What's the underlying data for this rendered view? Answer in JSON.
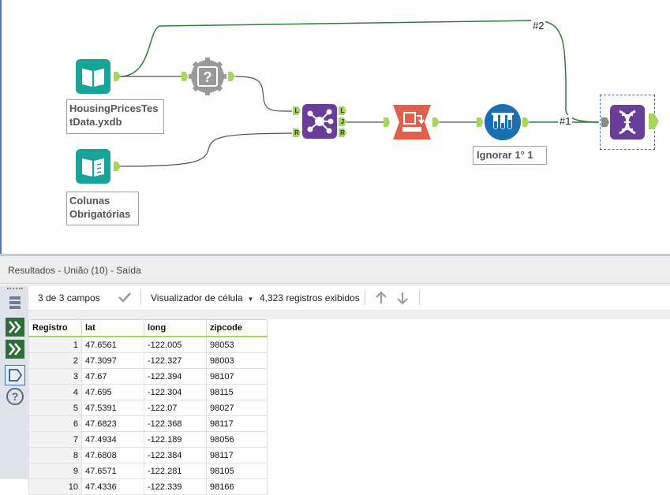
{
  "canvas": {
    "tools": {
      "input_housing": {
        "label": "HousingPricesTestData.yxdb",
        "label_line1": "HousingPricesTes",
        "label_line2": "tData.yxdb"
      },
      "input_columns": {
        "label_line1": "Colunas",
        "label_line2": "Obrigatórias"
      },
      "sample": {
        "label": "Ignorar 1° 1"
      }
    },
    "join_anchors": {
      "left": "L",
      "right": "R",
      "out_left": "L",
      "out_join": "J",
      "out_right": "R"
    },
    "wire_labels": {
      "connection_1": "#1",
      "connection_2": "#2"
    },
    "colors": {
      "input_tool": "#17a39a",
      "join_tool": "#6a3d9a",
      "formula_tool": "#e0604a",
      "sample_tool": "#1a6fb0",
      "union_tool": "#6a3d9a",
      "wire_main": "#505050",
      "wire_selected": "#2e7d3a",
      "anchor": "#a6d65e"
    }
  },
  "results": {
    "title": "Resultados - União (10) - Saída",
    "toolbar": {
      "fields": "3 de 3 campos",
      "viewer": "Visualizador de célula",
      "records": "4,323 registros exibidos"
    },
    "columns": [
      "Registro",
      "lat",
      "long",
      "zipcode"
    ],
    "rows": [
      [
        "1",
        "47.6561",
        "-122.005",
        "98053"
      ],
      [
        "2",
        "47.3097",
        "-122.327",
        "98003"
      ],
      [
        "3",
        "47.67",
        "-122.394",
        "98107"
      ],
      [
        "4",
        "47.695",
        "-122.304",
        "98115"
      ],
      [
        "5",
        "47.5391",
        "-122.07",
        "98027"
      ],
      [
        "6",
        "47.6823",
        "-122.368",
        "98117"
      ],
      [
        "7",
        "47.4934",
        "-122.189",
        "98056"
      ],
      [
        "8",
        "47.6808",
        "-122.384",
        "98117"
      ],
      [
        "9",
        "47.6571",
        "-122.281",
        "98105"
      ],
      [
        "10",
        "47.4336",
        "-122.339",
        "98166"
      ]
    ]
  }
}
